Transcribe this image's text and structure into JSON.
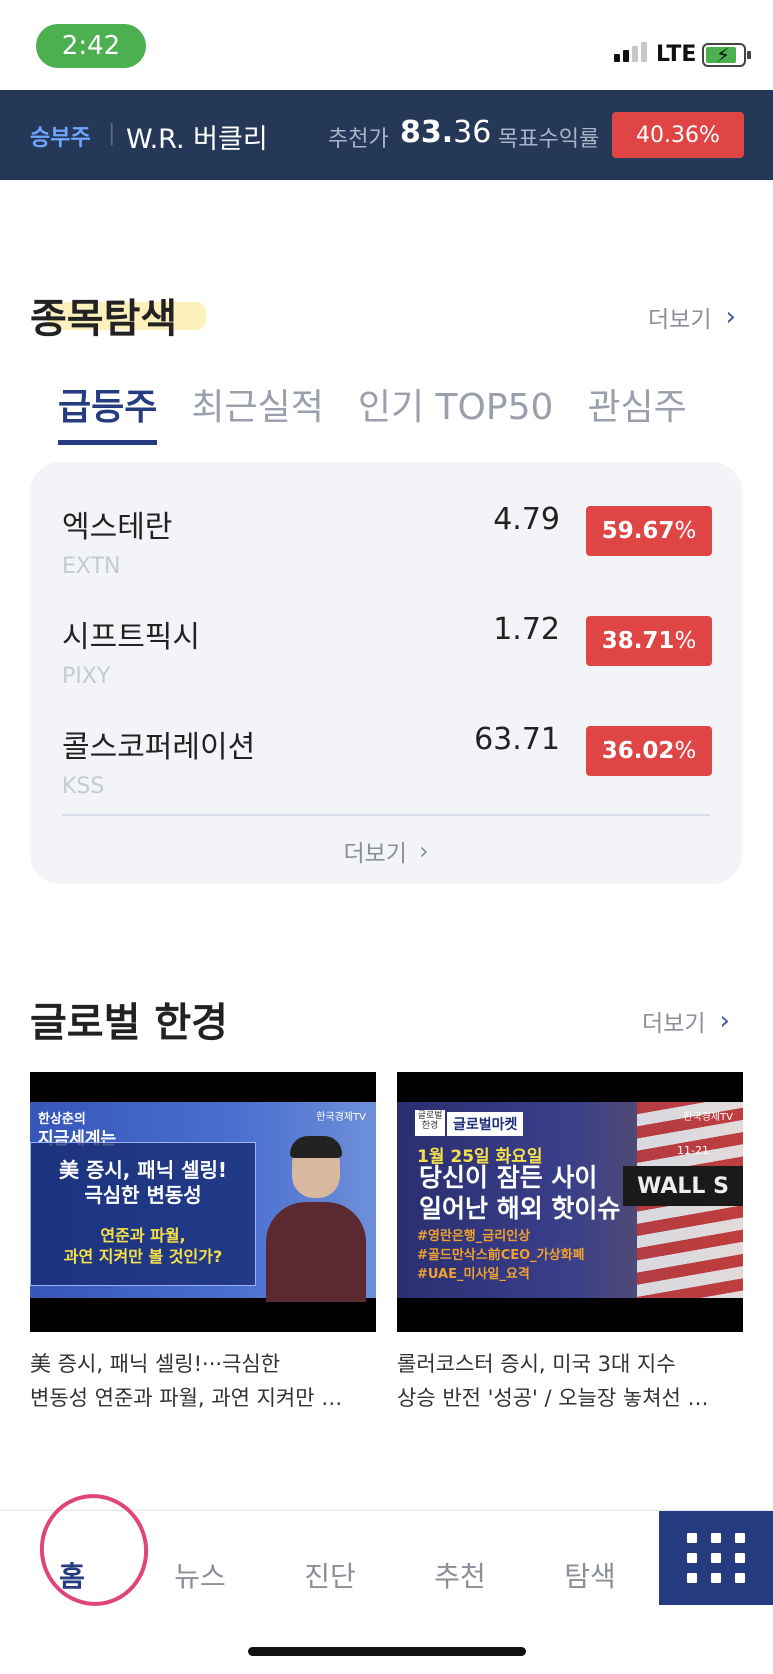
{
  "status_bar": {
    "time": "2:42",
    "network": "LTE",
    "battery_state": "charging"
  },
  "ticker_banner": {
    "tag": "승부주",
    "company": "W.R. 버클리",
    "price_label": "추천가",
    "price_int": "83.",
    "price_dec": "36",
    "target_label": "목표수익률",
    "target_value": "40.36%"
  },
  "stock_section": {
    "title": "종목탐색",
    "more_label": "더보기",
    "tabs": [
      {
        "label": "급등주",
        "active": true
      },
      {
        "label": "최근실적",
        "active": false
      },
      {
        "label": "인기 TOP50",
        "active": false
      },
      {
        "label": "관심주",
        "active": false
      }
    ],
    "rows": [
      {
        "name": "엑스테란",
        "ticker": "EXTN",
        "price_int": "4.",
        "price_dec": "79",
        "change_int": "59.67",
        "change_unit": "%"
      },
      {
        "name": "시프트픽시",
        "ticker": "PIXY",
        "price_int": "1.",
        "price_dec": "72",
        "change_int": "38.71",
        "change_unit": "%"
      },
      {
        "name": "콜스코퍼레이션",
        "ticker": "KSS",
        "price_int": "63.",
        "price_dec": "71",
        "change_int": "36.02",
        "change_unit": "%"
      }
    ],
    "card_more_label": "더보기"
  },
  "global_section": {
    "title": "글로벌 한경",
    "more_label": "더보기",
    "videos": [
      {
        "thumb_brand_top": "한상춘의",
        "thumb_brand": "지금세계는",
        "thumb_tv": "한국경제TV",
        "thumb_headline_1": "美 증시, 패닉 셀링!",
        "thumb_headline_2": "극심한 변동성",
        "thumb_sub_1": "연준과 파월,",
        "thumb_sub_2": "과연 지켜만 볼 것인가?",
        "caption_line1": "美 증시, 패닉 셀링!···극심한",
        "caption_line2": "변동성 연준과 파월, 과연 지켜만 …"
      },
      {
        "thumb_logo": "글로벌 한경",
        "thumb_program": "글로벌마켓",
        "thumb_tv": "한국경제TV",
        "thumb_date": "1월 25일 화요일",
        "thumb_headline_1": "당신이 잠든 사이",
        "thumb_headline_2": "일어난 해외 핫이슈",
        "thumb_tag_1": "#영란은행_금리인상",
        "thumb_tag_2": "#골드만삭스前CEO_가상화폐",
        "thumb_tag_3": "#UAE_미사일_요격",
        "thumb_sign": "WALL S",
        "thumb_sign_top": "11-21",
        "caption_line1": "롤러코스터 증시, 미국 3대 지수",
        "caption_line2": "상승 반전 '성공' / 오늘장 놓쳐선 …"
      }
    ]
  },
  "bottom_nav": {
    "items": [
      {
        "label": "홈",
        "active": true
      },
      {
        "label": "뉴스",
        "active": false
      },
      {
        "label": "진단",
        "active": false
      },
      {
        "label": "추천",
        "active": false
      },
      {
        "label": "탐색",
        "active": false
      }
    ],
    "menu_icon": "grid-menu-icon"
  },
  "colors": {
    "navy": "#253858",
    "accent_blue": "#253d80",
    "badge_red": "#e04545",
    "annotation_pink": "#e0457a"
  }
}
